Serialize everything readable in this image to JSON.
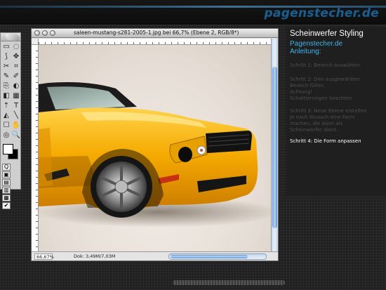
{
  "site": {
    "brand": "pagenstecher.de"
  },
  "photoshop": {
    "document": {
      "title": "saleen-mustang-s281-2005-1.jpg bei 66,7% (Ebene 2, RGB/8*)",
      "zoom": "66,67%",
      "doc_size": "Dok: 3,49M/7,03M"
    },
    "tools": [
      "▭",
      "◌",
      "⟆",
      "✥",
      "✂",
      "⌗",
      "✎",
      "✐",
      "⎘",
      "◐",
      "◧",
      "▦",
      "⇡",
      "T",
      "◭",
      "╲",
      "☐",
      "✋",
      "◎",
      "🔍"
    ],
    "toolbox_bottom": [
      "Q",
      "▣",
      "▤",
      "▥",
      "▦",
      "✔"
    ]
  },
  "panel": {
    "title": "Scheinwerfer Styling",
    "subtitle1": "Pagenstecher.de",
    "subtitle2": "Anleitung:",
    "steps": [
      {
        "line1": "Schritt 1: Bereich auswählen",
        "line2": "",
        "line3": "",
        "line4": "",
        "active": false
      },
      {
        "line1": "Schritt 2: Den ausgewählten",
        "line2": "Bereich füllen.",
        "line3": "Achtung!",
        "line4": "Schattierungen beachten",
        "active": false
      },
      {
        "line1": "Schritt 3: Neue Ebene erstellen",
        "line2": "Je nach Wunsch eine Form",
        "line3": "machen, die dann als",
        "line4": "Scheinwerfer dient.",
        "active": false
      },
      {
        "line1": "Schritt 4: Die Form anpassen",
        "line2": "",
        "line3": "",
        "line4": "",
        "active": true
      }
    ]
  },
  "colors": {
    "accent": "#3fb2ee",
    "car": "#f2a800",
    "brand": "#1d5d8c"
  }
}
